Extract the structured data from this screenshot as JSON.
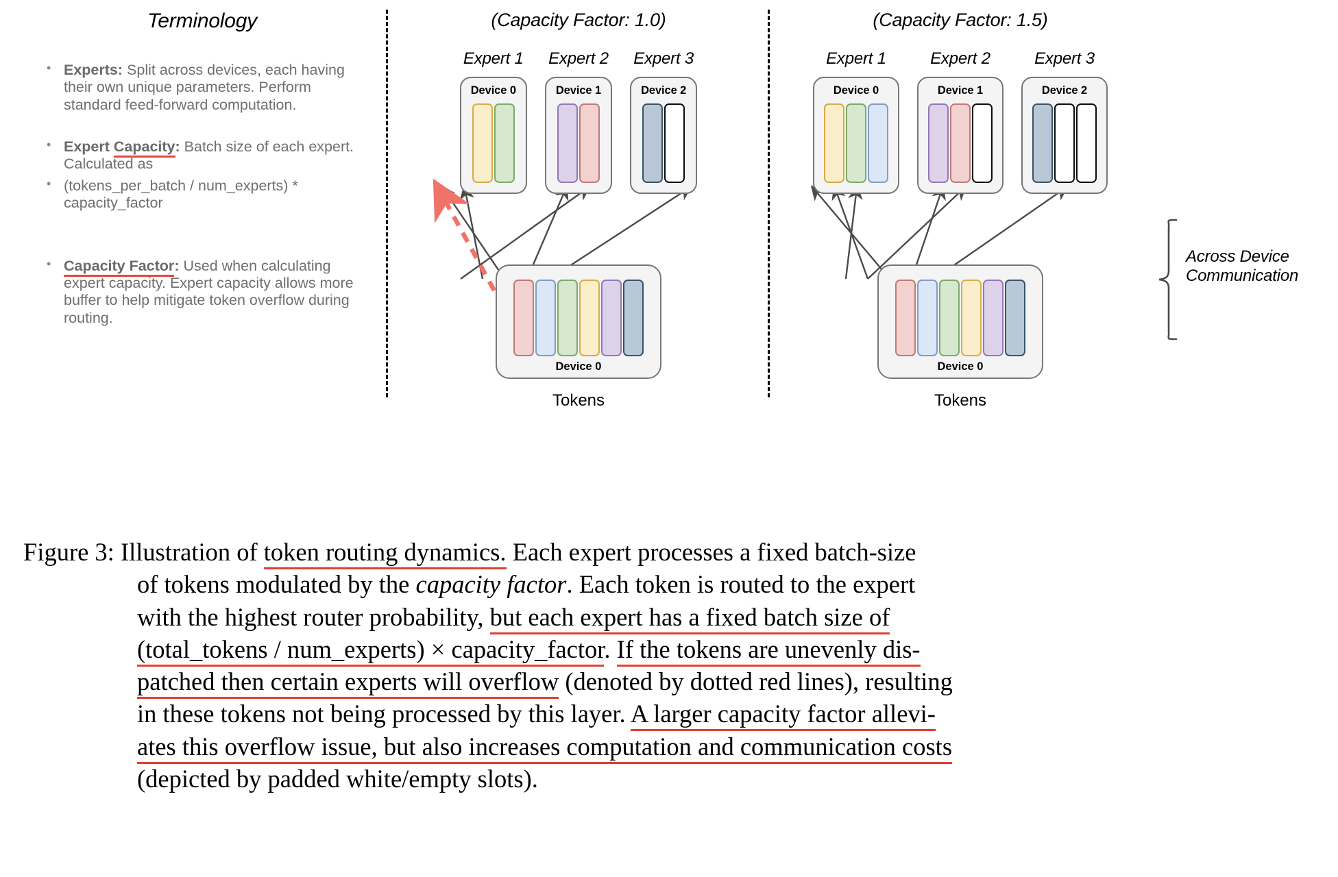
{
  "terminology": {
    "title": "Terminology",
    "items": [
      {
        "lead": "Experts:",
        "lead_underline": false,
        "text": " Split across devices, each having their own unique parameters. Perform standard feed-forward computation."
      },
      {
        "lead": "Expert Capacity:",
        "lead_underline": true,
        "lead_plain": "Expert ",
        "lead_red": "Capacity",
        "text": " Batch size of each expert. Calculated as"
      },
      {
        "lead": "",
        "lead_underline": false,
        "text": "(tokens_per_batch / num_experts) * capacity_factor"
      },
      {
        "lead": "Capacity Factor:",
        "lead_underline": true,
        "lead_red": "Capacity Factor",
        "text": " Used when calculating expert capacity. Expert capacity allows more buffer to help mitigate token overflow during routing."
      }
    ]
  },
  "panels": [
    {
      "id": "cf1",
      "title": "(Capacity Factor: 1.0)",
      "capacity_factor": "1.0",
      "slots_per_expert": 2,
      "experts": [
        {
          "label": "Expert 1",
          "device": "Device 0",
          "slots": [
            "yellow",
            "green"
          ]
        },
        {
          "label": "Expert 2",
          "device": "Device 1",
          "slots": [
            "purple",
            "red"
          ]
        },
        {
          "label": "Expert 3",
          "device": "Device 2",
          "slots": [
            "steel",
            "empty"
          ]
        }
      ],
      "bank": {
        "device": "Device 0",
        "caption": "Tokens",
        "tokens": [
          "red",
          "blue",
          "green",
          "yellow",
          "purple",
          "steel"
        ]
      },
      "overflow_token": "blue",
      "overflow_target": "Expert 1"
    },
    {
      "id": "cf15",
      "title": "(Capacity Factor: 1.5)",
      "capacity_factor": "1.5",
      "slots_per_expert": 3,
      "experts": [
        {
          "label": "Expert 1",
          "device": "Device 0",
          "slots": [
            "yellow",
            "green",
            "blue"
          ]
        },
        {
          "label": "Expert 2",
          "device": "Device 1",
          "slots": [
            "purple",
            "red",
            "empty"
          ]
        },
        {
          "label": "Expert 3",
          "device": "Device 2",
          "slots": [
            "steel",
            "empty",
            "empty"
          ]
        }
      ],
      "bank": {
        "device": "Device 0",
        "caption": "Tokens",
        "tokens": [
          "red",
          "blue",
          "green",
          "yellow",
          "purple",
          "steel"
        ]
      },
      "overflow_token": null,
      "overflow_target": null
    }
  ],
  "annotation": {
    "across_line1": "Across Device",
    "across_line2": "Communication"
  },
  "colors": {
    "red": "#f2d2d0",
    "red_border": "#c07a74",
    "blue": "#dbe7f7",
    "blue_border": "#7f9dc4",
    "green": "#d6e8cf",
    "green_border": "#7fa86a",
    "yellow": "#fbeeca",
    "yellow_border": "#d7ab4a",
    "purple": "#ded2ea",
    "purple_border": "#9478b5",
    "steel": "#b8c8d6",
    "steel_border": "#37546b",
    "empty": "#ffffff",
    "empty_border": "#0b0b0b",
    "accent_underline": "#e8453c",
    "overflow_arrow": "#f0736a",
    "arrow": "#4a4a4a",
    "device_bg": "#f4f4f4",
    "device_border": "#777777"
  },
  "caption": {
    "label": "Figure 3:",
    "lines": [
      [
        {
          "t": "Illustration of "
        },
        {
          "t": "token routing dynamics.",
          "u": true
        },
        {
          "t": " Each expert processes a fixed batch-size"
        }
      ],
      [
        {
          "t": "of tokens modulated by the "
        },
        {
          "t": "capacity factor",
          "i": true
        },
        {
          "t": ". Each token is routed to the expert"
        }
      ],
      [
        {
          "t": "with the highest router probability, "
        },
        {
          "t": "but each expert has a fixed batch size of",
          "u": true
        }
      ],
      [
        {
          "t": "(total_tokens / num_experts) × capacity_factor",
          "u": true
        },
        {
          "t": ". "
        },
        {
          "t": "If the tokens are unevenly dis-",
          "u": true
        }
      ],
      [
        {
          "t": "patched then certain experts will overflow",
          "u": true
        },
        {
          "t": " (denoted by dotted red lines), resulting"
        }
      ],
      [
        {
          "t": "in these tokens not being processed by this layer. "
        },
        {
          "t": "A larger capacity factor allevi-",
          "u": true
        }
      ],
      [
        {
          "t": "ates this overflow issue, but also increases computation and communication costs",
          "u": true
        }
      ],
      [
        {
          "t": "(depicted by padded white/empty slots)."
        }
      ]
    ]
  }
}
